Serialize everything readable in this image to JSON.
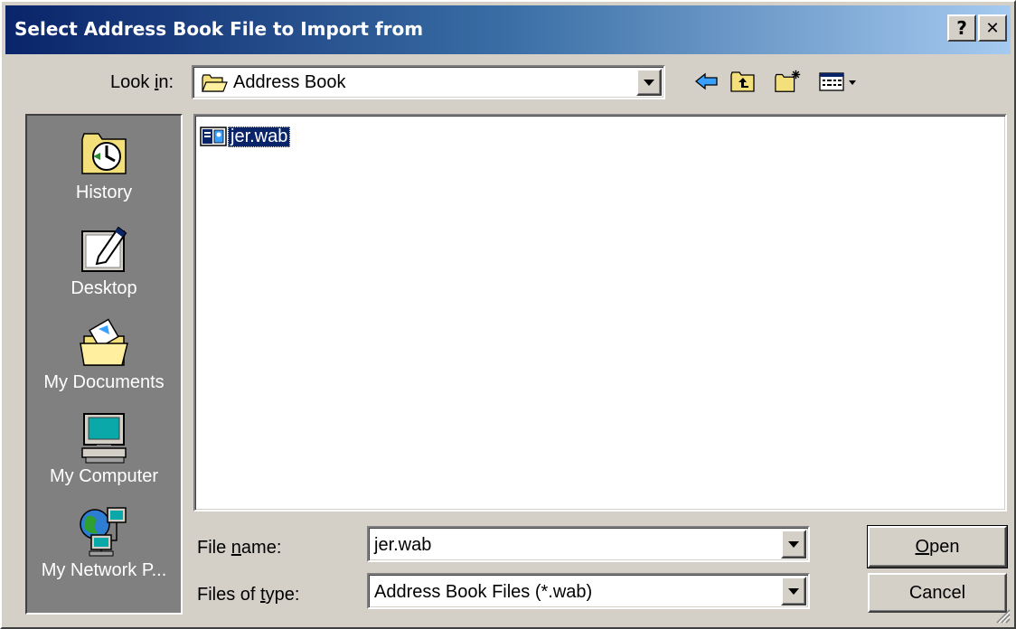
{
  "window": {
    "title": "Select Address Book File to Import from",
    "help_label": "?",
    "close_label": "✕"
  },
  "look_in": {
    "label": "Look in:",
    "value": "Address Book"
  },
  "toolbar": {
    "buttons": [
      "back-icon",
      "up-one-level-icon",
      "new-folder-icon",
      "view-menu-icon"
    ]
  },
  "places": {
    "items": [
      {
        "label": "History",
        "icon": "history-icon"
      },
      {
        "label": "Desktop",
        "icon": "desktop-icon"
      },
      {
        "label": "My Documents",
        "icon": "my-documents-icon"
      },
      {
        "label": "My Computer",
        "icon": "my-computer-icon"
      },
      {
        "label": "My Network P...",
        "icon": "my-network-places-icon"
      }
    ]
  },
  "files": [
    {
      "name": "jer.wab",
      "icon": "address-book-file-icon",
      "selected": true
    }
  ],
  "file_name": {
    "label": "File name:",
    "value": "jer.wab"
  },
  "file_type": {
    "label": "Files of type:",
    "value": "Address Book Files (*.wab)"
  },
  "buttons": {
    "open": "Open",
    "cancel": "Cancel"
  },
  "colors": {
    "title_gradient_start": "#0a246a",
    "title_gradient_end": "#a6caf0",
    "face": "#d4d0c8",
    "places_bg": "#808080",
    "selection": "#0a246a"
  }
}
